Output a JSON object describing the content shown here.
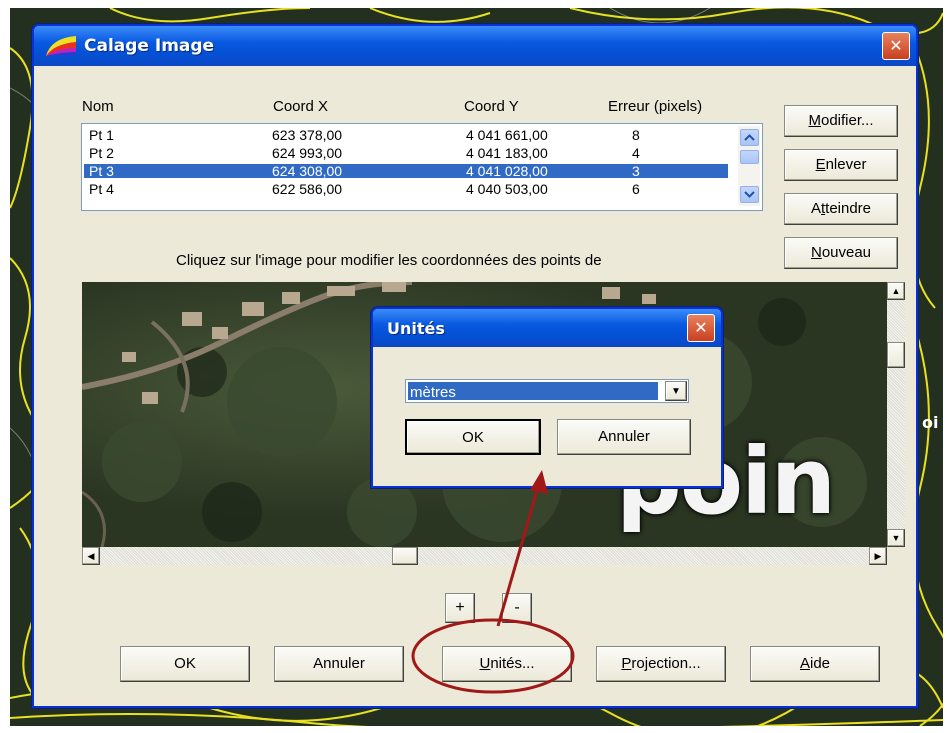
{
  "dialog": {
    "title": "Calage Image",
    "close_label": "✕",
    "columns": [
      "Nom",
      "Coord X",
      "Coord Y",
      "Erreur (pixels)"
    ],
    "points": [
      {
        "nom": "Pt 1",
        "x": "623 378,00",
        "y": "4 041 661,00",
        "err": "8"
      },
      {
        "nom": "Pt 2",
        "x": "624 993,00",
        "y": "4 041 183,00",
        "err": "4"
      },
      {
        "nom": "Pt 3",
        "x": "624 308,00",
        "y": "4 041 028,00",
        "err": "3"
      },
      {
        "nom": "Pt 4",
        "x": "622 586,00",
        "y": "4 040 503,00",
        "err": "6"
      }
    ],
    "selected_row": "Pt 3",
    "side_buttons": {
      "modifier": {
        "pre": "",
        "key": "M",
        "post": "odifier..."
      },
      "enlever": {
        "pre": "",
        "key": "E",
        "post": "nlever"
      },
      "atteindre": {
        "pre": "A",
        "key": "t",
        "post": "teindre"
      },
      "nouveau": {
        "pre": "",
        "key": "N",
        "post": "ouveau"
      }
    },
    "instruction": "Cliquez sur l'image pour modifier les coordonnées des points de",
    "image_overlay_text": "poin",
    "zoom_in": "+",
    "zoom_out": "-",
    "bottom_buttons": {
      "ok": "OK",
      "annuler": "Annuler",
      "unites": {
        "pre": "",
        "key": "U",
        "post": "nités..."
      },
      "projection": {
        "pre": "",
        "key": "P",
        "post": "rojection..."
      },
      "aide": {
        "pre": "",
        "key": "A",
        "post": "ide"
      }
    }
  },
  "units_dialog": {
    "title": "Unités",
    "close_label": "✕",
    "select_value": "mètres",
    "ok": "OK",
    "annuler": "Annuler"
  },
  "background_fragment": "oi",
  "colors": {
    "annotation": "#a01818",
    "selection": "#316ac5",
    "title_bar": "#0453d8",
    "contours": "#e8e020"
  }
}
